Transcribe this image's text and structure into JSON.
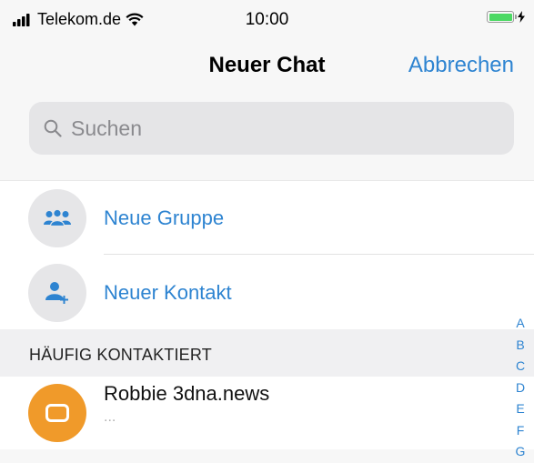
{
  "status_bar": {
    "carrier": "Telekom.de",
    "time": "10:00",
    "battery_color": "#4cd964"
  },
  "nav": {
    "title": "Neuer Chat",
    "cancel_label": "Abbrechen"
  },
  "search": {
    "placeholder": "Suchen",
    "icon": "magnifier-icon"
  },
  "actions": [
    {
      "label": "Neue Gruppe",
      "icon": "group-icon"
    },
    {
      "label": "Neuer Kontakt",
      "icon": "add-contact-icon"
    }
  ],
  "section_header": "HÄUFIG KONTAKTIERT",
  "contacts": [
    {
      "name": "Robbie 3dna.news",
      "subtitle": "...",
      "avatar_color": "#f09a2a"
    }
  ],
  "index_letters": [
    "A",
    "B",
    "C",
    "D",
    "E",
    "F",
    "G"
  ],
  "accent_color": "#2e84d1"
}
